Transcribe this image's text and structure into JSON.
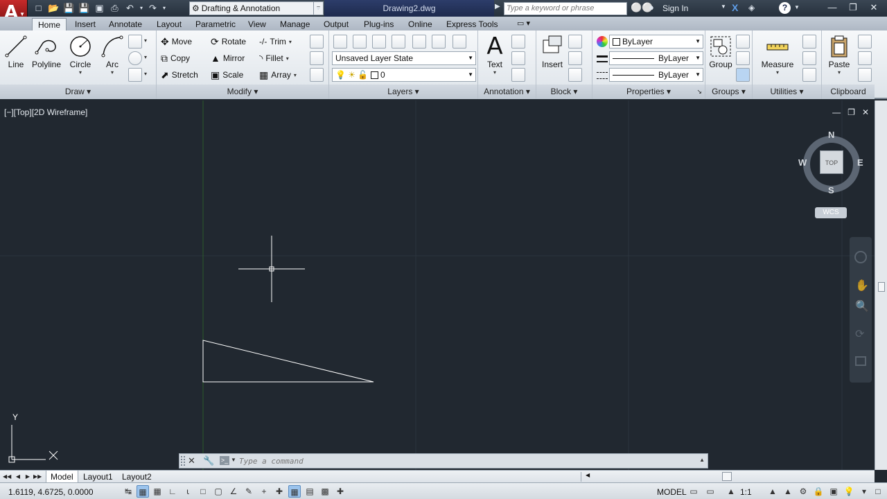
{
  "app": {
    "document_title": "Drawing2.dwg",
    "workspace": "Drafting & Annotation",
    "search_placeholder": "Type a keyword or phrase",
    "sign_in": "Sign In"
  },
  "ribbon_tabs": [
    {
      "label": "Home",
      "active": true
    },
    {
      "label": "Insert"
    },
    {
      "label": "Annotate"
    },
    {
      "label": "Layout"
    },
    {
      "label": "Parametric"
    },
    {
      "label": "View"
    },
    {
      "label": "Manage"
    },
    {
      "label": "Output"
    },
    {
      "label": "Plug-ins"
    },
    {
      "label": "Online"
    },
    {
      "label": "Express Tools"
    }
  ],
  "panels": {
    "draw": {
      "title": "Draw",
      "line": "Line",
      "polyline": "Polyline",
      "circle": "Circle",
      "arc": "Arc"
    },
    "modify": {
      "title": "Modify",
      "move": "Move",
      "rotate": "Rotate",
      "trim": "Trim",
      "copy": "Copy",
      "mirror": "Mirror",
      "fillet": "Fillet",
      "stretch": "Stretch",
      "scale": "Scale",
      "array": "Array"
    },
    "layers": {
      "title": "Layers",
      "layer_state": "Unsaved Layer State",
      "current_layer": "0"
    },
    "annotation": {
      "title": "Annotation",
      "text": "Text"
    },
    "block": {
      "title": "Block",
      "insert": "Insert"
    },
    "properties": {
      "title": "Properties",
      "color": "ByLayer",
      "linetype": "ByLayer",
      "lineweight": "ByLayer"
    },
    "groups": {
      "title": "Groups",
      "group": "Group"
    },
    "utilities": {
      "title": "Utilities",
      "measure": "Measure"
    },
    "clipboard": {
      "title": "Clipboard",
      "paste": "Paste"
    }
  },
  "viewport": {
    "label": "[−][Top][2D Wireframe]",
    "viewcube": {
      "north": "N",
      "south": "S",
      "east": "E",
      "west": "W",
      "face": "TOP"
    },
    "wcs": "WCS",
    "ucs_y": "Y"
  },
  "command_line": {
    "placeholder": "Type a command"
  },
  "layout_tabs": [
    {
      "label": "Model",
      "active": true
    },
    {
      "label": "Layout1"
    },
    {
      "label": "Layout2"
    }
  ],
  "status": {
    "coordinates": "1.6119, 4.6725, 0.0000",
    "space": "MODEL",
    "annotation_scale": "1:1"
  },
  "colors": {
    "canvas": "#212830",
    "accent": "#c62a2a",
    "title_bar": "#25303c"
  }
}
